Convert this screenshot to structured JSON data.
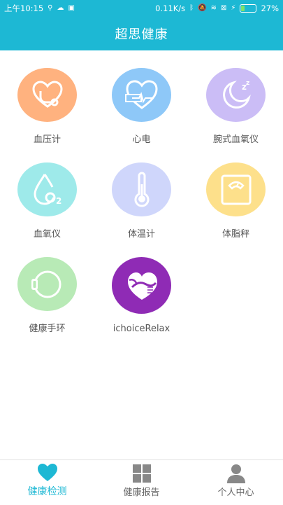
{
  "status_bar": {
    "time": "上午10:15",
    "net_speed": "0.11K/s",
    "battery": "27%"
  },
  "header": {
    "title": "超思健康"
  },
  "devices": [
    {
      "label": "血压计",
      "icon": "stethoscope-heart-icon",
      "color": "#ffb27f"
    },
    {
      "label": "心电",
      "icon": "ecg-heart-icon",
      "color": "#8ec8f8"
    },
    {
      "label": "腕式血氧仪",
      "icon": "moon-sleep-icon",
      "color": "#cbbdf6"
    },
    {
      "label": "血氧仪",
      "icon": "oxygen-drop-icon",
      "color": "#9eeaea"
    },
    {
      "label": "体温计",
      "icon": "thermometer-icon",
      "color": "#cfd6fb"
    },
    {
      "label": "体脂秤",
      "icon": "scale-icon",
      "color": "#fde08b"
    },
    {
      "label": "健康手环",
      "icon": "wristband-icon",
      "color": "#b8eab6"
    },
    {
      "label": "ichoiceRelax",
      "icon": "relax-heart-icon",
      "color": "#8f2bb5"
    }
  ],
  "tabs": [
    {
      "label": "健康检测",
      "icon": "heart-icon",
      "active": true
    },
    {
      "label": "健康报告",
      "icon": "grid-icon",
      "active": false
    },
    {
      "label": "个人中心",
      "icon": "person-icon",
      "active": false
    }
  ],
  "colors": {
    "accent": "#1db8d4"
  }
}
